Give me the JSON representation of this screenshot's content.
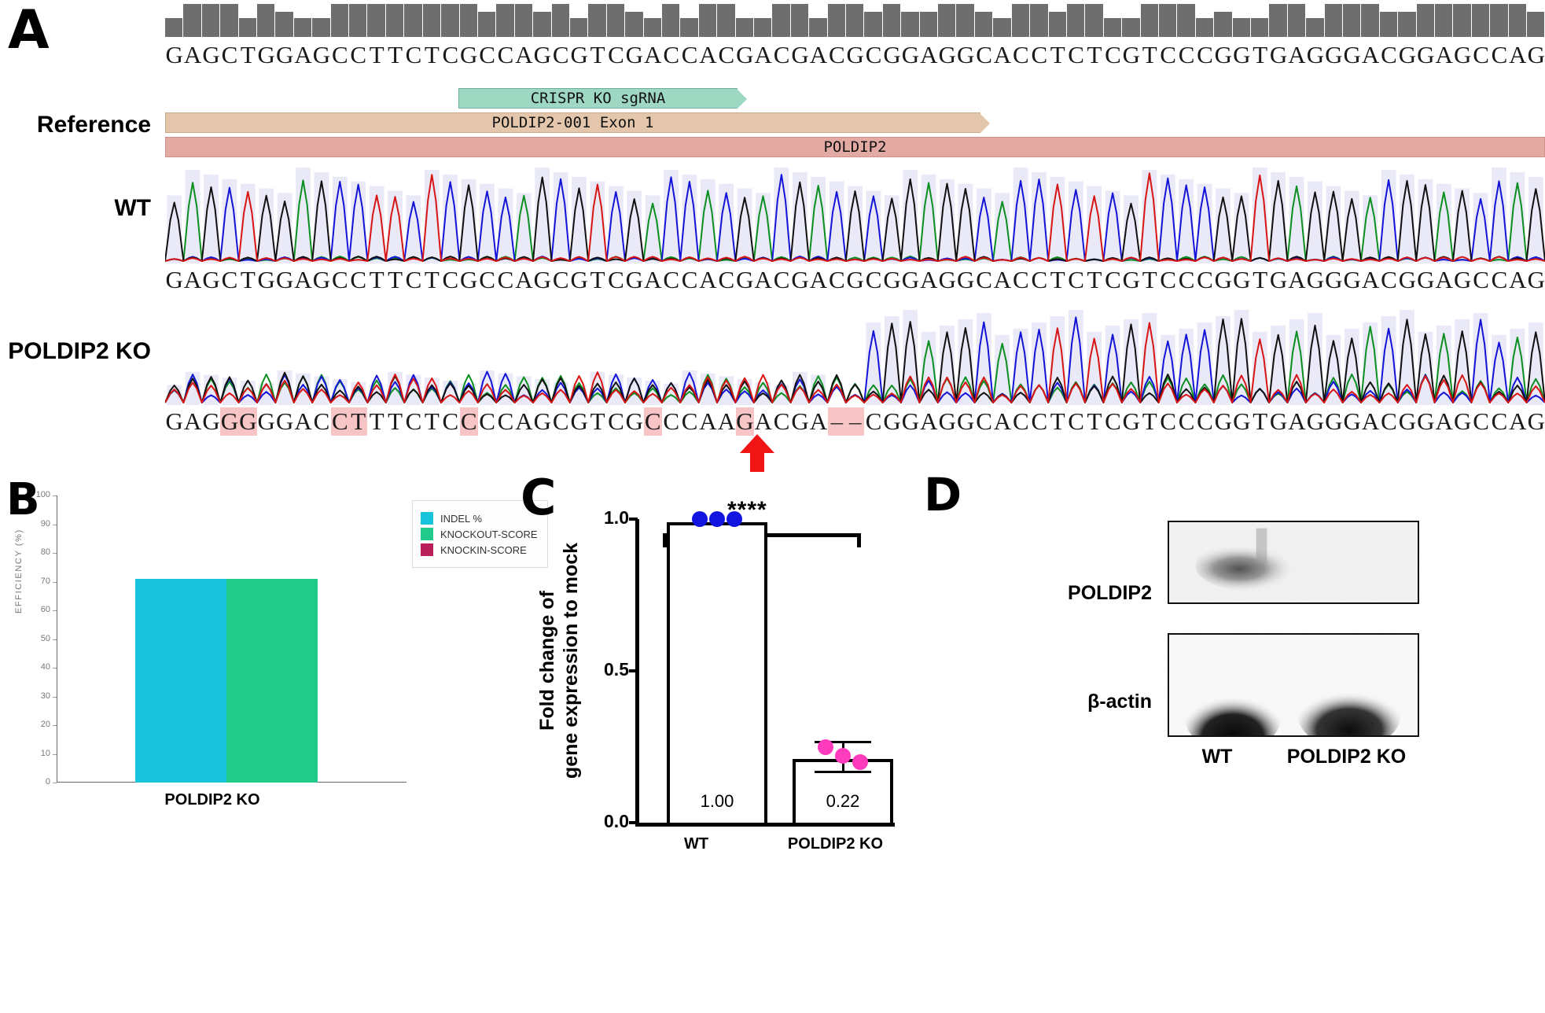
{
  "figure": {
    "panels": [
      {
        "letter": "A"
      },
      {
        "letter": "B"
      },
      {
        "letter": "C"
      },
      {
        "letter": "D"
      }
    ]
  },
  "panelA": {
    "row_labels": {
      "reference": "Reference",
      "wt": "WT",
      "ko": "POLDIP2 KO"
    },
    "reference_sequence": "GAGCTGGAGCCTTCTCGCCAGCGTCGACCACGACGACGCGGAGGCACCTCTCGTCCCGGTGAGGGACGGAGCCAG",
    "wt_sequence": "GAGCTGGAGCCTTCTCGCCAGCGTCGACCACGACGACGCGGAGGCACCTCTCGTCCCGGTGAGGGACGGAGCCAG",
    "ko_sequence": "GAGGGGGACCTTTCTCCCCAGCGTCGCCCAAGACGA--CGGAGGCACCTCTCGTCCCGGTGAGGGACGGAGCCAG",
    "ko_highlight_indices": [
      3,
      4,
      9,
      10,
      16,
      26,
      31,
      36,
      37
    ],
    "annotations": {
      "sgrna": "CRISPR KO sgRNA",
      "exon": "POLDIP2-001 Exon 1",
      "gene": "POLDIP2"
    },
    "deletion_marker": "red-arrow-deletion"
  },
  "panelB": {
    "chart_data": {
      "type": "bar",
      "title": "",
      "xlabel": "",
      "ylabel": "EFFICIENCY (%)",
      "categories": [
        "POLDIP2 KO"
      ],
      "ylim": [
        0,
        100
      ],
      "yticks": [
        "0",
        "10",
        "20",
        "30",
        "40",
        "50",
        "60",
        "70",
        "80",
        "90",
        "100"
      ],
      "grid": false,
      "legend_position": "right",
      "series": [
        {
          "name": "INDEL %",
          "values": [
            71
          ],
          "color": "#17c3dd"
        },
        {
          "name": "KNOCKOUT-SCORE",
          "values": [
            71
          ],
          "color": "#21c98a"
        },
        {
          "name": "KNOCKIN-SCORE",
          "values": [
            0
          ],
          "color": "#b81e58"
        }
      ]
    }
  },
  "panelC": {
    "chart_data": {
      "type": "bar",
      "title": "",
      "xlabel": "",
      "ylabel": "Fold change of\ngene expression to mock",
      "ylabel_line1": "Fold change of",
      "ylabel_line2": "gene expression to mock",
      "categories": [
        "WT",
        "POLDIP2 KO"
      ],
      "values": [
        1.0,
        0.22
      ],
      "value_labels": [
        "1.00",
        "0.22"
      ],
      "ylim": [
        0.0,
        1.0
      ],
      "yticks": [
        "0.0",
        "0.5",
        "1.0"
      ],
      "grid": false,
      "points": [
        {
          "group": "WT",
          "values": [
            1.0,
            1.0,
            1.0
          ],
          "color": "#1414e0"
        },
        {
          "group": "POLDIP2 KO",
          "values": [
            0.25,
            0.22,
            0.2
          ],
          "color": "#ff3bbd"
        }
      ],
      "annotations": [
        {
          "text": "****",
          "type": "significance-bracket",
          "between": [
            "WT",
            "POLDIP2 KO"
          ]
        }
      ]
    }
  },
  "panelD": {
    "blots": [
      {
        "label": "POLDIP2"
      },
      {
        "label": "β-actin"
      }
    ],
    "lanes": [
      "WT",
      "POLDIP2 KO"
    ]
  }
}
